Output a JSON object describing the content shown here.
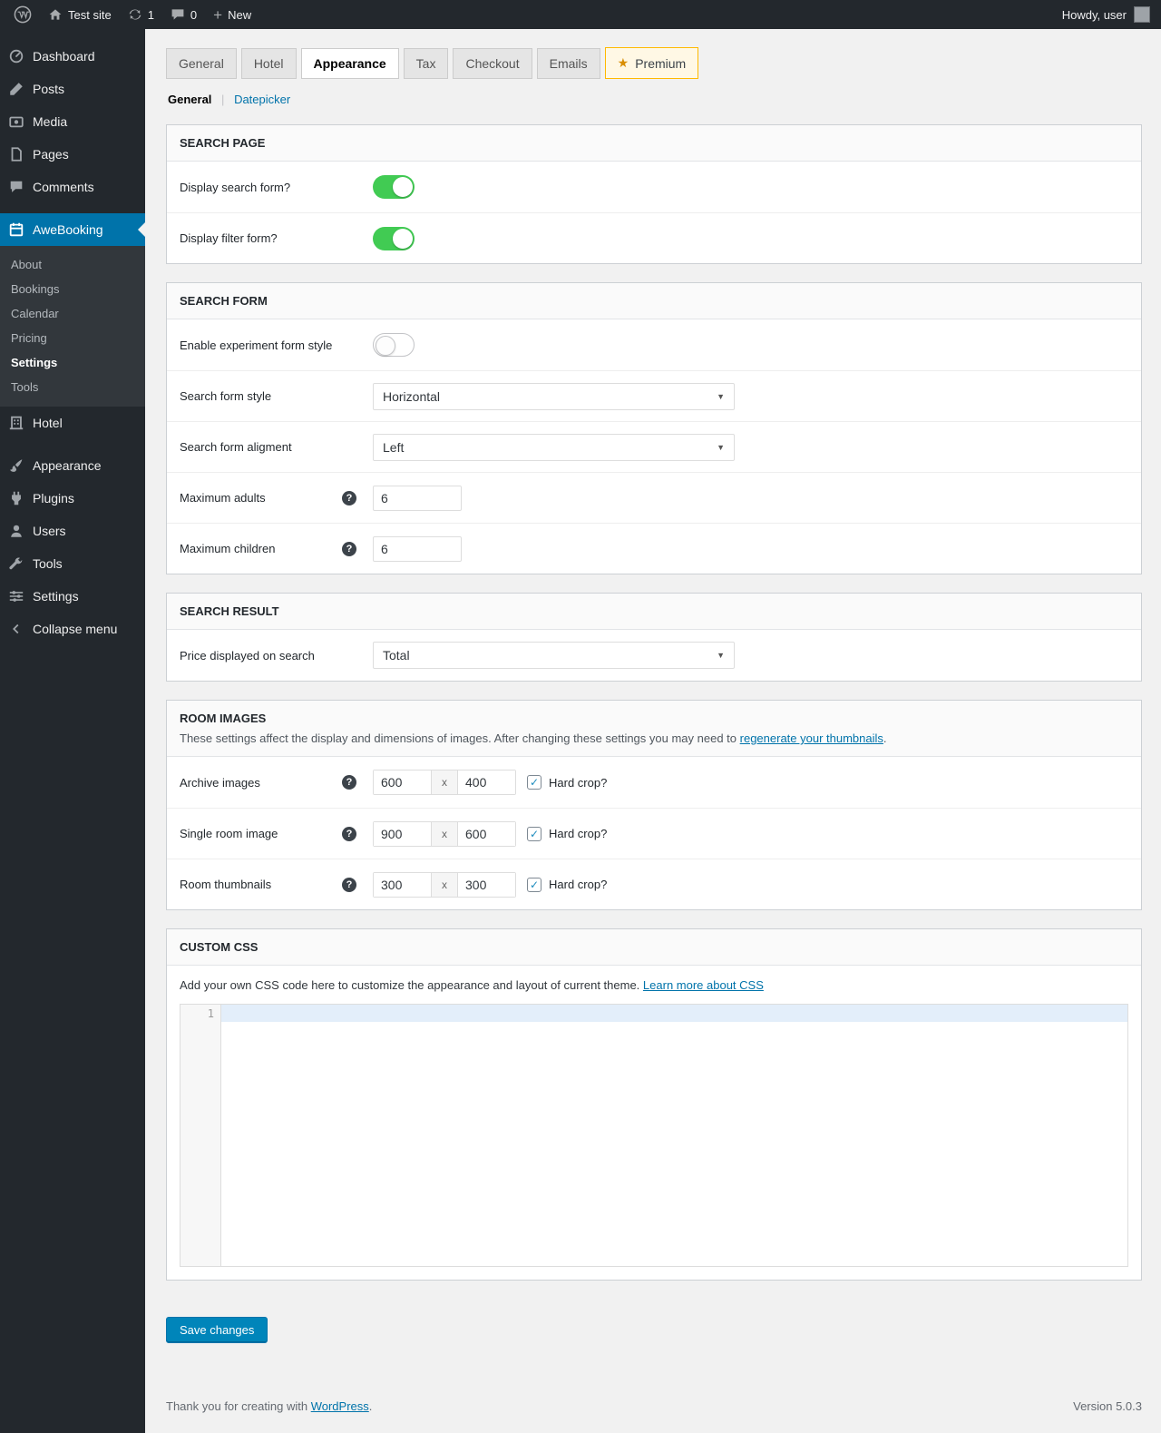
{
  "colors": {
    "accent_green": "#41cb53",
    "link_blue": "#0073aa",
    "active_menu_blue": "#0073aa",
    "premium_yellow_border": "#ffb900",
    "premium_yellow_bg": "#fff8e5",
    "save_button_blue": "#0085ba",
    "admin_dark": "#23282d"
  },
  "icons": {
    "premium_star": "★",
    "select_arrow": "▼",
    "help_glyph": "?",
    "check_glyph": "✓",
    "plus_glyph": "+"
  },
  "admin_bar": {
    "site_name": "Test site",
    "update_count": "1",
    "comment_count": "0",
    "new_label": "New",
    "howdy": "Howdy, user"
  },
  "sidebar": {
    "menu": [
      {
        "label": "Dashboard"
      },
      {
        "label": "Posts"
      },
      {
        "label": "Media"
      },
      {
        "label": "Pages"
      },
      {
        "label": "Comments"
      },
      {
        "label": "AweBooking"
      },
      {
        "label": "Hotel"
      },
      {
        "label": "Appearance"
      },
      {
        "label": "Plugins"
      },
      {
        "label": "Users"
      },
      {
        "label": "Tools"
      },
      {
        "label": "Settings"
      },
      {
        "label": "Collapse menu"
      }
    ],
    "awebooking_submenu": [
      {
        "label": "About"
      },
      {
        "label": "Bookings"
      },
      {
        "label": "Calendar"
      },
      {
        "label": "Pricing"
      },
      {
        "label": "Settings"
      },
      {
        "label": "Tools"
      }
    ]
  },
  "tabs": [
    {
      "label": "General"
    },
    {
      "label": "Hotel"
    },
    {
      "label": "Appearance"
    },
    {
      "label": "Tax"
    },
    {
      "label": "Checkout"
    },
    {
      "label": "Emails"
    },
    {
      "label": "Premium"
    }
  ],
  "subnav": {
    "general": "General",
    "separator": "|",
    "datepicker": "Datepicker"
  },
  "search_page": {
    "title": "SEARCH PAGE",
    "display_search_form_label": "Display search form?",
    "display_search_form_state": "on",
    "display_filter_form_label": "Display filter form?",
    "display_filter_form_state": "on"
  },
  "search_form": {
    "title": "SEARCH FORM",
    "experiment_label": "Enable experiment form style",
    "experiment_state": "off",
    "style_label": "Search form style",
    "style_value": "Horizontal",
    "alignment_label": "Search form aligment",
    "alignment_value": "Left",
    "max_adults_label": "Maximum adults",
    "max_adults_value": "6",
    "max_children_label": "Maximum children",
    "max_children_value": "6"
  },
  "search_result": {
    "title": "SEARCH RESULT",
    "price_label": "Price displayed on search",
    "price_value": "Total"
  },
  "room_images": {
    "title": "ROOM IMAGES",
    "description_text": "These settings affect the display and dimensions of images. After changing these settings you may need to ",
    "description_link": "regenerate your thumbnails",
    "description_suffix": ".",
    "dimension_separator": "x",
    "hard_crop_label": "Hard crop?",
    "rows": [
      {
        "label": "Archive images",
        "width": "600",
        "height": "400",
        "hard_crop": true
      },
      {
        "label": "Single room image",
        "width": "900",
        "height": "600",
        "hard_crop": true
      },
      {
        "label": "Room thumbnails",
        "width": "300",
        "height": "300",
        "hard_crop": true
      }
    ]
  },
  "custom_css": {
    "title": "CUSTOM CSS",
    "description_text": "Add your own CSS code here to customize the appearance and layout of current theme. ",
    "description_link": "Learn more about CSS",
    "line_number": "1"
  },
  "save_button_label": "Save changes",
  "footer": {
    "thanks_prefix": "Thank you for creating with ",
    "wordpress_link": "WordPress",
    "thanks_suffix": ".",
    "version": "Version 5.0.3"
  }
}
